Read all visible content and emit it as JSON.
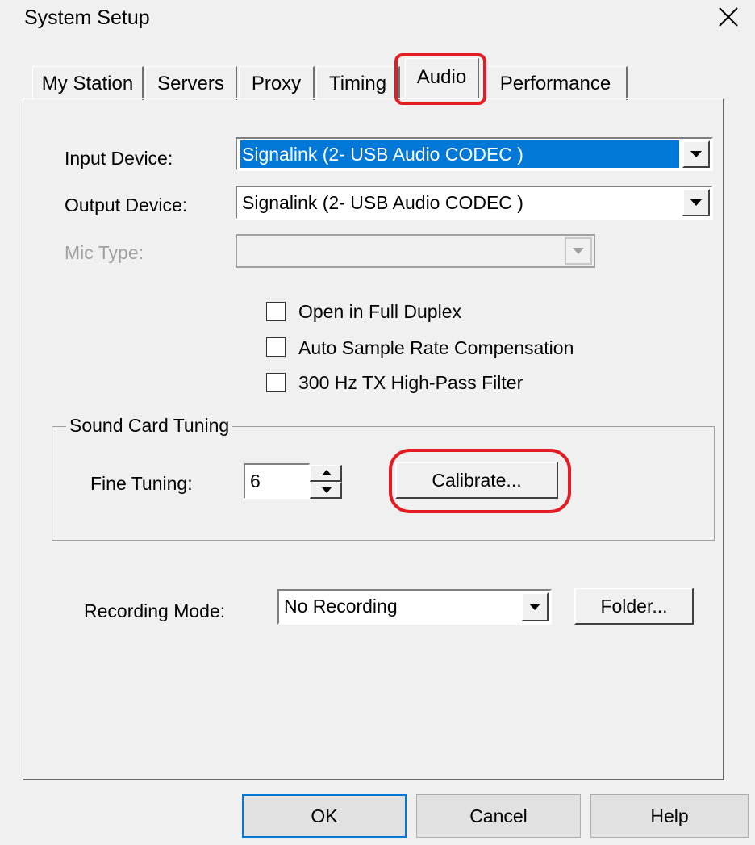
{
  "window": {
    "title": "System Setup"
  },
  "tabs": [
    {
      "label": "My Station"
    },
    {
      "label": "Servers"
    },
    {
      "label": "Proxy"
    },
    {
      "label": "Timing"
    },
    {
      "label": "Audio"
    },
    {
      "label": "Performance"
    }
  ],
  "active_tab": "Audio",
  "audio": {
    "input_device_label": "Input Device:",
    "input_device_value": "Signalink (2- USB Audio CODEC )",
    "output_device_label": "Output Device:",
    "output_device_value": "Signalink (2- USB Audio CODEC )",
    "mic_type_label": "Mic Type:",
    "mic_type_value": "",
    "options": [
      {
        "label": "Open in Full Duplex",
        "checked": false
      },
      {
        "label": "Auto Sample Rate Compensation",
        "checked": false
      },
      {
        "label": "300 Hz TX High-Pass Filter",
        "checked": false
      }
    ],
    "tuning_group_title": "Sound Card Tuning",
    "fine_tuning_label": "Fine Tuning:",
    "fine_tuning_value": "6",
    "calibrate_label": "Calibrate...",
    "recording_mode_label": "Recording Mode:",
    "recording_mode_value": "No Recording",
    "folder_label": "Folder..."
  },
  "footer": {
    "ok_label": "OK",
    "cancel_label": "Cancel",
    "help_label": "Help"
  },
  "colors": {
    "highlight": "#0078d7",
    "annotation": "#e31b23"
  }
}
